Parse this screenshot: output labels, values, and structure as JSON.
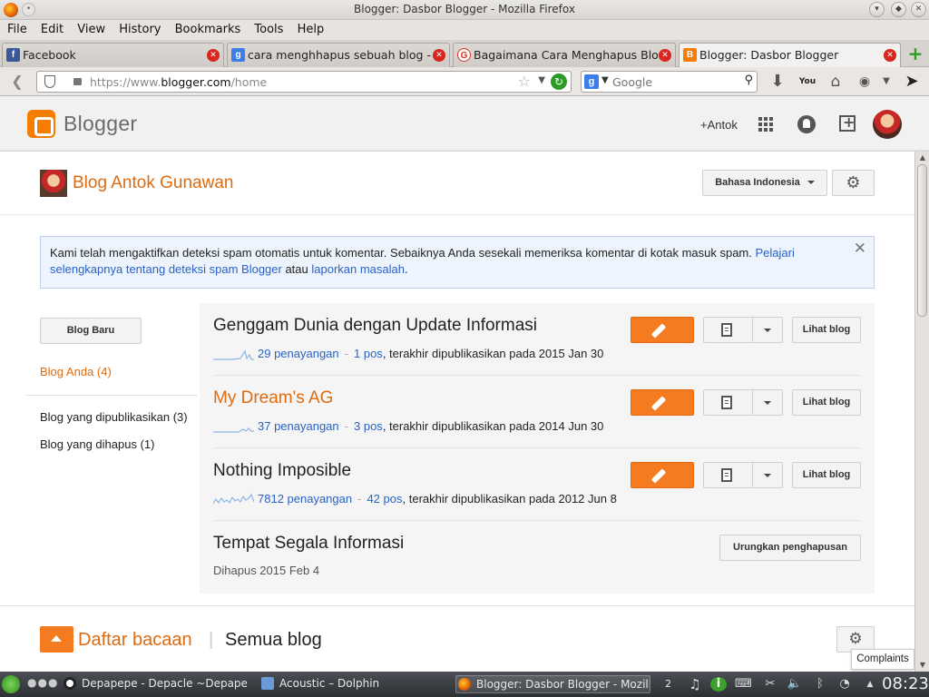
{
  "window": {
    "title": "Blogger: Dasbor Blogger - Mozilla Firefox"
  },
  "menu": [
    "File",
    "Edit",
    "View",
    "History",
    "Bookmarks",
    "Tools",
    "Help"
  ],
  "tabs": [
    {
      "label": "Facebook",
      "icon": "facebook-icon"
    },
    {
      "label": "cara menghhapus sebuah blog - ...",
      "icon": "google-icon"
    },
    {
      "label": "Bagaimana Cara Menghapus Blo...",
      "icon": "google-red-icon"
    },
    {
      "label": "Blogger: Dasbor Blogger",
      "icon": "blogger-icon",
      "active": true
    }
  ],
  "nav": {
    "url_prefix": "https://www.",
    "url_domain": "blogger.com",
    "url_path": "/home",
    "search_placeholder": "Google"
  },
  "header": {
    "logo_text": "Blogger",
    "user_link": "+Antok"
  },
  "blog_head": {
    "name": "Blog Antok Gunawan",
    "language": "Bahasa Indonesia"
  },
  "notice": {
    "text": "Kami telah mengaktifkan deteksi spam otomatis untuk komentar. Sebaiknya Anda sesekali memeriksa komentar di kotak masuk spam. ",
    "link1": "Pelajari selengkapnya tentang deteksi spam Blogger",
    "mid": " atau ",
    "link2": "laporkan masalah",
    "end": ".",
    "close": "✕"
  },
  "sidebar": {
    "new_blog": "Blog Baru",
    "your_blogs": "Blog Anda (4)",
    "published": "Blog yang dipublikasikan (3)",
    "deleted": "Blog yang dihapus (1)"
  },
  "blogs": [
    {
      "name": "Genggam Dunia dengan Update Informasi",
      "views": "29 penayangan",
      "posts": "1 pos",
      "last": ", terakhir dipublikasikan pada 2015 Jan 30",
      "view_label": "Lihat blog",
      "highlight": false
    },
    {
      "name": "My Dream's AG",
      "views": "37 penayangan",
      "posts": "3 pos",
      "last": ", terakhir dipublikasikan pada 2014 Jun 30",
      "view_label": "Lihat blog",
      "highlight": true
    },
    {
      "name": "Nothing Imposible",
      "views": "7812 penayangan",
      "posts": "42 pos",
      "last": ", terakhir dipublikasikan pada 2012 Jun 8",
      "view_label": "Lihat blog",
      "highlight": false
    },
    {
      "name": "Tempat Segala Informasi",
      "deleted_text": "Dihapus 2015 Feb 4",
      "undo_label": "Urungkan penghapusan"
    }
  ],
  "reading": {
    "title": "Daftar bacaan",
    "separator": "|",
    "all": "Semua blog",
    "complaints": "Complaints"
  },
  "taskbar": {
    "tasks": [
      "Depapepe - Depacle ~Depapepe F",
      "Acoustic – Dolphin",
      "Blogger: Dasbor Blogger - Mozilla"
    ],
    "desktop": "2",
    "clock": "08:23"
  },
  "colors": {
    "accent": "#f47b20",
    "link": "#2962c6",
    "blog_title": "#dd6b10"
  }
}
